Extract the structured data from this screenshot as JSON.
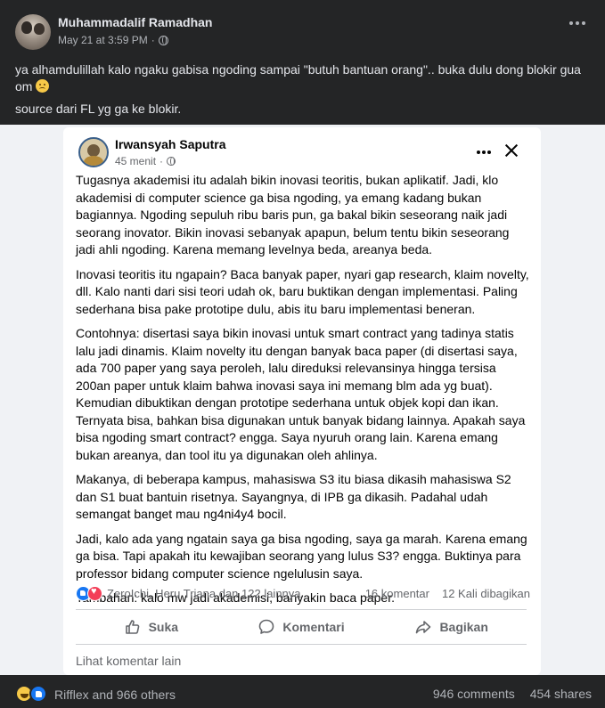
{
  "outer_post": {
    "author": "Muhammadalif Ramadhan",
    "timestamp": "May 21 at 3:59 PM",
    "separator": "·",
    "text_line1": "ya alhamdulillah kalo ngaku gabisa ngoding sampai \"butuh bantuan orang\".. buka dulu dong blokir gua om",
    "text_line2": "source dari FL yg ga ke blokir.",
    "reactions_summary": "Rifflex and 966 others",
    "comments_count": "946 comments",
    "shares_count": "454 shares"
  },
  "inner_post": {
    "author": "Irwansyah Saputra",
    "timestamp": "45 menit",
    "separator": "·",
    "paragraphs": [
      "Tugasnya akademisi itu adalah bikin inovasi teoritis, bukan aplikatif. Jadi, klo akademisi di computer science ga bisa ngoding, ya emang kadang bukan bagiannya. Ngoding sepuluh ribu baris pun, ga bakal bikin seseorang naik jadi seorang inovator. Bikin inovasi sebanyak apapun, belum tentu bikin seseorang jadi ahli ngoding. Karena memang levelnya beda, areanya beda.",
      "Inovasi teoritis itu ngapain? Baca banyak paper, nyari gap research, klaim novelty, dll. Kalo nanti dari sisi teori udah ok, baru buktikan dengan implementasi. Paling sederhana bisa pake prototipe dulu, abis itu baru implementasi beneran.",
      "Contohnya: disertasi saya bikin inovasi untuk smart contract yang tadinya statis lalu jadi dinamis. Klaim novelty itu dengan banyak baca paper (di disertasi saya, ada 700 paper yang saya peroleh, lalu direduksi relevansinya hingga tersisa 200an paper untuk klaim bahwa inovasi saya ini memang blm ada yg buat). Kemudian dibuktikan dengan prototipe sederhana untuk objek kopi dan ikan. Ternyata bisa, bahkan bisa digunakan untuk banyak bidang lainnya. Apakah saya bisa ngoding smart contract? engga. Saya nyuruh orang lain. Karena emang bukan areanya, dan tool itu ya digunakan oleh ahlinya.",
      "Makanya, di beberapa kampus, mahasiswa S3 itu biasa dikasih mahasiswa S2 dan S1 buat bantuin risetnya. Sayangnya, di IPB ga dikasih. Padahal udah semangat banget mau ng4ni4y4 bocil.",
      "Jadi, kalo ada yang ngatain saya ga bisa ngoding, saya ga marah. Karena emang ga bisa. Tapi apakah itu kewajiban seorang yang lulus S3? engga. Buktinya para professor bidang computer science ngelulusin saya.",
      "Tambahan: kalo mw jadi akademisi, banyakin baca paper."
    ],
    "reaction_names": "ZeroIchi, Heru Triana dan 122 lainnya",
    "comments_count": "16 komentar",
    "shares_count": "12 Kali dibagikan",
    "actions": {
      "like": "Suka",
      "comment": "Komentari",
      "share": "Bagikan"
    },
    "more_comments": "Lihat komentar lain"
  }
}
